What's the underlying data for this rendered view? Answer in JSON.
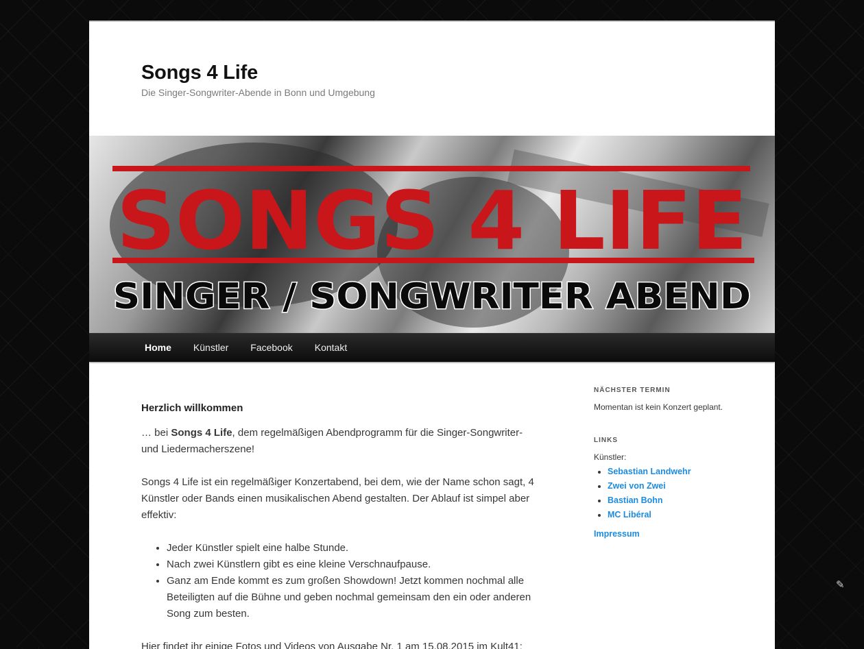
{
  "site": {
    "title": "Songs 4 Life",
    "description": "Die Singer-Songwriter-Abende in Bonn und Umgebung"
  },
  "header_image": {
    "line1": "SONGS 4 LIFE",
    "line2": "SINGER / SONGWRITER ABEND",
    "colors": {
      "red": "#c8161b",
      "black": "#0a0a0a"
    }
  },
  "nav": {
    "items": [
      "Home",
      "Künstler",
      "Facebook",
      "Kontakt"
    ],
    "current": "Home"
  },
  "post": {
    "title": "Herzlich willkommen",
    "intro_prefix": "… bei ",
    "intro_strong": "Songs 4 Life",
    "intro_suffix": ", dem regelmäßigen Abendprogramm für die Singer-Songwriter- und Liedermacherszene!",
    "para2": "Songs 4 Life ist ein regelmäßiger Konzertabend, bei dem, wie der Name schon sagt, 4 Künstler oder Bands einen musikalischen Abend gestalten. Der Ablauf ist simpel aber effektiv:",
    "list": [
      "Jeder Künstler spielt eine halbe Stunde.",
      "Nach zwei Künstlern gibt es eine kleine Verschnaufpause.",
      "Ganz am Ende kommt es zum großen Showdown! Jetzt kommen nochmal alle Beteiligten auf die Bühne und geben nochmal gemeinsam den ein oder anderen Song zum besten."
    ],
    "para3": "Hier findet ihr einige Fotos und Videos von Ausgabe Nr. 1 am 15.08.2015 im Kult41:"
  },
  "sidebar": {
    "next_title": "Nächster Termin",
    "next_text": "Momentan ist kein Konzert geplant.",
    "links_title": "Links",
    "links_label": "Künstler:",
    "artists": [
      "Sebastian Landwehr",
      "Zwei von Zwei",
      "Bastian Bohn",
      "MC Libéral"
    ],
    "impressum": "Impressum"
  },
  "colors": {
    "link": "#1b8be0",
    "background": "#0b0b0b",
    "nav": "#1a1a1a"
  },
  "icons": {
    "corner": "pen-icon"
  }
}
